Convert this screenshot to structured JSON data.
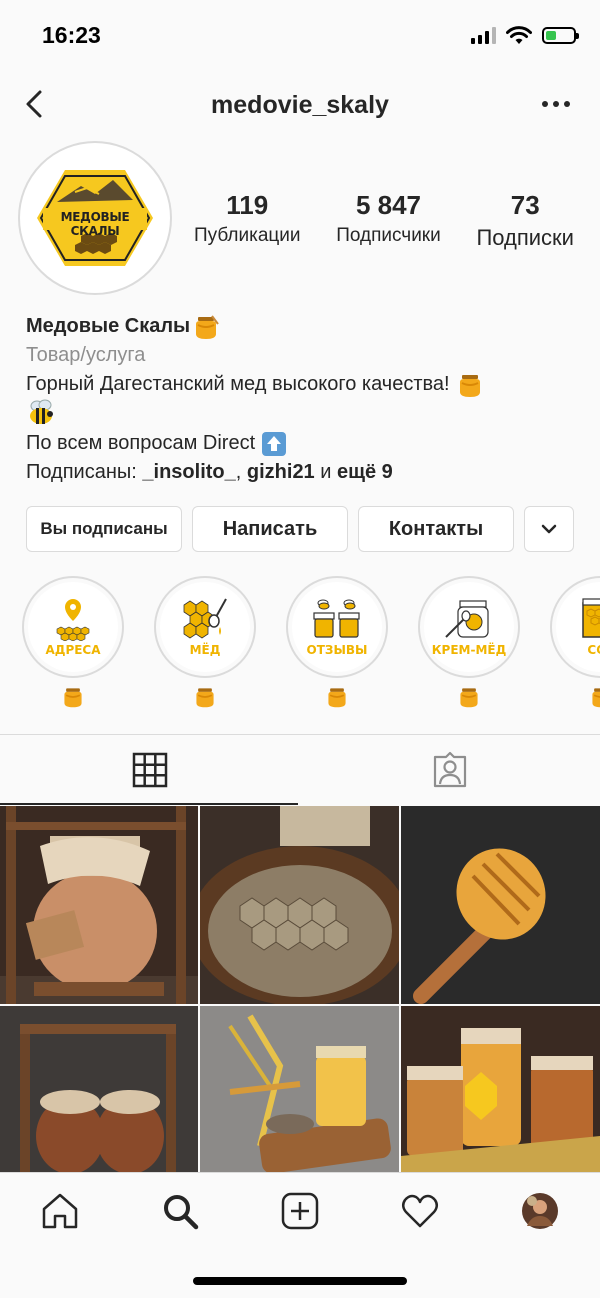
{
  "status_bar": {
    "time": "16:23"
  },
  "header": {
    "username": "medovie_skaly"
  },
  "profile": {
    "avatar_logo_text": "МЕДОВЫЕ СКАЛЫ",
    "stats": [
      {
        "value": "119",
        "label": "Публикации"
      },
      {
        "value": "5 847",
        "label": "Подписчики"
      },
      {
        "value": "73",
        "label": "Подписки"
      }
    ]
  },
  "bio": {
    "name": "Медовые Скалы",
    "category": "Товар/услуга",
    "line1": "Горный Дагестанский мед высокого качества!",
    "line2": "По всем вопросам Direct",
    "followed_prefix": "Подписаны:",
    "followed_user1": "_insolito_",
    "followed_separator": ",",
    "followed_user2": "gizhi21",
    "followed_and": "и",
    "followed_more": "ещё 9"
  },
  "buttons": {
    "following": "Вы подписаны",
    "message": "Написать",
    "contacts": "Контакты"
  },
  "highlights": [
    {
      "title": "АДРЕСА",
      "icon": "location-honeycomb-icon"
    },
    {
      "title": "МЁД",
      "icon": "honeycomb-dipper-icon"
    },
    {
      "title": "ОТЗЫВЫ",
      "icon": "honey-jars-bees-icon"
    },
    {
      "title": "КРЕМ-МЁД",
      "icon": "cream-honey-jar-icon"
    },
    {
      "title": "СОТ",
      "icon": "honeycomb-frame-icon"
    }
  ],
  "colors": {
    "honey": "#f0b400",
    "accent_text": "#262626",
    "muted_text": "#8e8e8e",
    "border": "#dbdbdb"
  }
}
